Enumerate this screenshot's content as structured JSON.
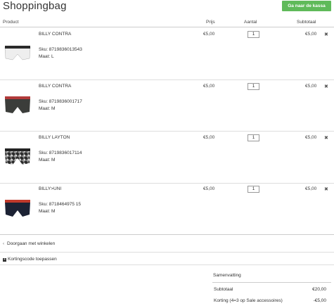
{
  "header": {
    "title": "Shoppingbag",
    "checkout_label": "Ga naar de kassa"
  },
  "columns": {
    "product": "Product",
    "price": "Prijs",
    "quantity": "Aantal",
    "subtotal": "Subtotaal"
  },
  "items": [
    {
      "name": "BILLY CONTRA",
      "sku": "Sku:  8719836013543",
      "size": "Maat:  L",
      "price": "€5,00",
      "qty": "1",
      "subtotal": "€5,00",
      "remove": "✖",
      "colors": {
        "body": "#eeeeee",
        "band": "#2a2a2a"
      }
    },
    {
      "name": "BILLY CONTRA",
      "sku": "Sku:  8719836001717",
      "size": "Maat:  M",
      "price": "€5,00",
      "qty": "1",
      "subtotal": "€5,00",
      "remove": "✖",
      "colors": {
        "body": "#3b3d3a",
        "band": "#b23a3a"
      }
    },
    {
      "name": "BILLY LAYTON",
      "sku": "Sku:  8719836017114",
      "size": "Maat:  M",
      "price": "€5,00",
      "qty": "1",
      "subtotal": "€5,00",
      "remove": "✖",
      "colors": {
        "body": "#7a7a7a",
        "band": "#222222"
      }
    },
    {
      "name": "BILLY>UNI",
      "sku": "Sku:  8718464975 15",
      "size": "Maat:  M",
      "price": "€5,00",
      "qty": "1",
      "subtotal": "€5,00",
      "remove": "✖",
      "colors": {
        "body": "#1c2234",
        "band": "#c0392b"
      }
    }
  ],
  "links": {
    "continue": "Doorgaan met winkelen",
    "coupon": "Kortingscode toepassen",
    "continue_icon": "chevron-left-icon",
    "coupon_icon": "plus-square-icon"
  },
  "summary": {
    "title": "Samenvatting",
    "subtotal_label": "Subtotaal",
    "subtotal_value": "€20,00",
    "discount_label": "Korting (4=3 op Sale accessoires)",
    "discount_value": "-€5,00"
  },
  "theme": {
    "accent": "#5fba5a"
  }
}
